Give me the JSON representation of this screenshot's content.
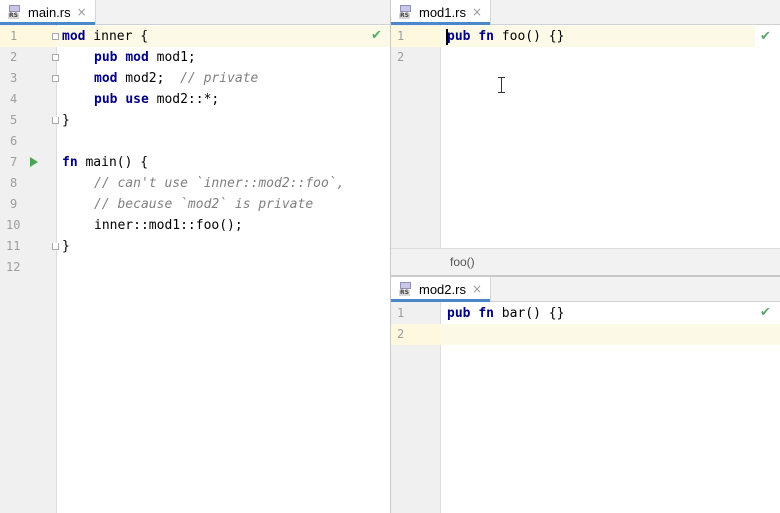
{
  "left": {
    "tab": {
      "label": "main.rs",
      "close": "×",
      "icon_text": "RS"
    },
    "lines": [
      {
        "n": "1"
      },
      {
        "n": "2"
      },
      {
        "n": "3"
      },
      {
        "n": "4"
      },
      {
        "n": "5"
      },
      {
        "n": "6"
      },
      {
        "n": "7"
      },
      {
        "n": "8"
      },
      {
        "n": "9"
      },
      {
        "n": "10"
      },
      {
        "n": "11"
      },
      {
        "n": "12"
      }
    ],
    "code": {
      "l1_kw": "mod",
      "l1_rest": " inner {",
      "l2_kw1": "pub",
      "l2_kw2": "mod",
      "l2_rest": " mod1;",
      "l3_kw": "mod",
      "l3_rest": " mod2;  ",
      "l3_cm": "// private",
      "l4_kw1": "pub",
      "l4_kw2": "use",
      "l4_rest": " mod2::*;",
      "l5_rest": "}",
      "l7_kw": "fn",
      "l7_rest": " main() {",
      "l8_cm": "// can't use `inner::mod2::foo`,",
      "l9_cm": "// because `mod2` is private",
      "l10_rest": "inner::mod1::foo();",
      "l11_rest": "}"
    },
    "status_mark": "✔"
  },
  "top_right": {
    "tab": {
      "label": "mod1.rs",
      "close": "×",
      "icon_text": "RS"
    },
    "lines": [
      {
        "n": "1"
      },
      {
        "n": "2"
      }
    ],
    "code": {
      "kw1": "pub",
      "kw2": "fn",
      "rest": " foo() {}"
    },
    "status_mark": "✔",
    "breadcrumb": "foo()"
  },
  "bottom_right": {
    "tab": {
      "label": "mod2.rs",
      "close": "×",
      "icon_text": "RS"
    },
    "lines": [
      {
        "n": "1"
      },
      {
        "n": "2"
      }
    ],
    "code": {
      "kw1": "pub",
      "kw2": "fn",
      "rest": " bar() {}"
    },
    "status_mark": "✔"
  },
  "colors": {
    "keyword": "#000080",
    "comment": "#808080",
    "current_line": "#fcfae6",
    "active_tab": "#4a88c7",
    "run": "#4ba355",
    "ok": "#59a869"
  }
}
